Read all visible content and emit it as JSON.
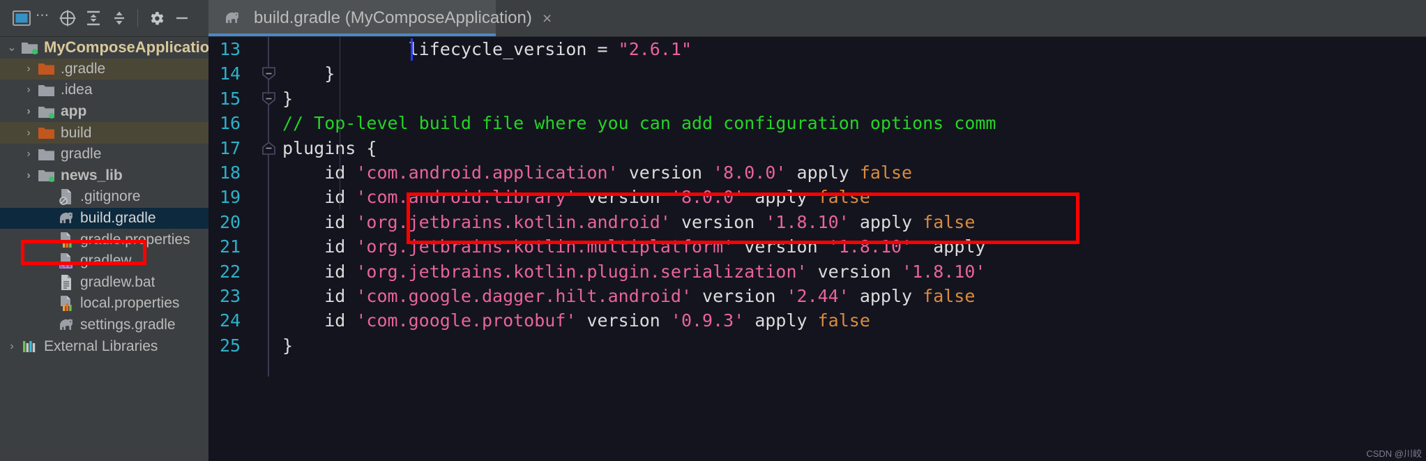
{
  "toolbar": {
    "icons": [
      {
        "name": "project-window-icon",
        "label": "Project"
      },
      {
        "name": "ellipsis-icon",
        "label": "..."
      },
      {
        "name": "select-opened-file-icon",
        "label": "Select Opened File"
      },
      {
        "name": "expand-all-icon",
        "label": "Expand All"
      },
      {
        "name": "collapse-all-icon",
        "label": "Collapse All"
      },
      {
        "name": "gear-icon",
        "label": "Settings"
      },
      {
        "name": "minimize-icon",
        "label": "Hide"
      }
    ]
  },
  "tab": {
    "title": "build.gradle (MyComposeApplication)",
    "close_label": "×",
    "icon": "gradle-elephant-icon",
    "active_underline_color": "#4a88c7"
  },
  "sidebar": {
    "items": [
      {
        "label": "MyComposeApplication",
        "icon": "module-folder-icon",
        "arrow": "⌄",
        "indent": 0,
        "state": "root"
      },
      {
        "label": ".gradle",
        "icon": "folder-orange-icon",
        "arrow": "›",
        "indent": 1,
        "state": "excluded"
      },
      {
        "label": ".idea",
        "icon": "folder-icon",
        "arrow": "›",
        "indent": 1,
        "state": "normal"
      },
      {
        "label": "app",
        "icon": "module-folder-icon",
        "arrow": "›",
        "indent": 1,
        "state": "bold"
      },
      {
        "label": "build",
        "icon": "folder-orange-icon",
        "arrow": "›",
        "indent": 1,
        "state": "excluded"
      },
      {
        "label": "gradle",
        "icon": "folder-icon",
        "arrow": "›",
        "indent": 1,
        "state": "normal"
      },
      {
        "label": "news_lib",
        "icon": "module-folder-icon",
        "arrow": "›",
        "indent": 1,
        "state": "bold"
      },
      {
        "label": ".gitignore",
        "icon": "gitignore-file-icon",
        "arrow": "",
        "indent": 2,
        "state": "normal"
      },
      {
        "label": "build.gradle",
        "icon": "gradle-elephant-icon",
        "arrow": "",
        "indent": 2,
        "state": "selected"
      },
      {
        "label": "gradle.properties",
        "icon": "properties-file-icon",
        "arrow": "",
        "indent": 2,
        "state": "normal"
      },
      {
        "label": "gradlew",
        "icon": "cpp-file-icon",
        "arrow": "",
        "indent": 2,
        "state": "normal"
      },
      {
        "label": "gradlew.bat",
        "icon": "text-file-icon",
        "arrow": "",
        "indent": 2,
        "state": "normal"
      },
      {
        "label": "local.properties",
        "icon": "properties-file-icon",
        "arrow": "",
        "indent": 2,
        "state": "normal"
      },
      {
        "label": "settings.gradle",
        "icon": "gradle-elephant-icon",
        "arrow": "",
        "indent": 2,
        "state": "normal"
      },
      {
        "label": "External Libraries",
        "icon": "libraries-icon",
        "arrow": "›",
        "indent": 0,
        "state": "normal"
      }
    ]
  },
  "editor": {
    "first_line_number": 13,
    "lines": [
      {
        "n": 13,
        "fold": "none",
        "tokens": [
          {
            "t": "            lifecycle_version = ",
            "c": "txt"
          },
          {
            "t": "\"2.6.1\"",
            "c": "str"
          }
        ]
      },
      {
        "n": 14,
        "fold": "end",
        "tokens": [
          {
            "t": "    }",
            "c": "txt"
          }
        ]
      },
      {
        "n": 15,
        "fold": "end",
        "tokens": [
          {
            "t": "}",
            "c": "txt"
          }
        ]
      },
      {
        "n": 16,
        "fold": "none",
        "tokens": [
          {
            "t": "// Top-level build file where you can add configuration options comm",
            "c": "com"
          }
        ]
      },
      {
        "n": 17,
        "fold": "start",
        "tokens": [
          {
            "t": "plugins {",
            "c": "txt"
          }
        ]
      },
      {
        "n": 18,
        "fold": "none",
        "tokens": [
          {
            "t": "    id ",
            "c": "txt"
          },
          {
            "t": "'com.android.application'",
            "c": "str"
          },
          {
            "t": " version ",
            "c": "txt"
          },
          {
            "t": "'8.0.0'",
            "c": "str"
          },
          {
            "t": " apply ",
            "c": "txt"
          },
          {
            "t": "false",
            "c": "kw"
          }
        ]
      },
      {
        "n": 19,
        "fold": "none",
        "tokens": [
          {
            "t": "    id ",
            "c": "txt"
          },
          {
            "t": "'com.android.library'",
            "c": "str"
          },
          {
            "t": " version ",
            "c": "txt"
          },
          {
            "t": "'8.0.0'",
            "c": "str"
          },
          {
            "t": " apply ",
            "c": "txt"
          },
          {
            "t": "false",
            "c": "kw"
          }
        ]
      },
      {
        "n": 20,
        "fold": "none",
        "tokens": [
          {
            "t": "    id ",
            "c": "txt"
          },
          {
            "t": "'org.jetbrains.kotlin.android'",
            "c": "str"
          },
          {
            "t": " version ",
            "c": "txt"
          },
          {
            "t": "'1.8.10'",
            "c": "str"
          },
          {
            "t": " apply ",
            "c": "txt"
          },
          {
            "t": "false",
            "c": "kw"
          }
        ]
      },
      {
        "n": 21,
        "fold": "none",
        "tokens": [
          {
            "t": "    id ",
            "c": "txt"
          },
          {
            "t": "'org.jetbrains.kotlin.multiplatform'",
            "c": "str"
          },
          {
            "t": " version ",
            "c": "txt"
          },
          {
            "t": "'1.8.10'",
            "c": "str"
          },
          {
            "t": "  apply",
            "c": "txt"
          }
        ]
      },
      {
        "n": 22,
        "fold": "none",
        "tokens": [
          {
            "t": "    id ",
            "c": "txt"
          },
          {
            "t": "'org.jetbrains.kotlin.plugin.serialization'",
            "c": "str"
          },
          {
            "t": " version ",
            "c": "txt"
          },
          {
            "t": "'1.8.10'",
            "c": "str"
          }
        ]
      },
      {
        "n": 23,
        "fold": "none",
        "tokens": [
          {
            "t": "    id ",
            "c": "txt"
          },
          {
            "t": "'com.google.dagger.hilt.android'",
            "c": "str"
          },
          {
            "t": " version ",
            "c": "txt"
          },
          {
            "t": "'2.44'",
            "c": "str"
          },
          {
            "t": " apply ",
            "c": "txt"
          },
          {
            "t": "false",
            "c": "kw"
          }
        ]
      },
      {
        "n": 24,
        "fold": "none",
        "tokens": [
          {
            "t": "    id ",
            "c": "txt"
          },
          {
            "t": "'com.google.protobuf'",
            "c": "str"
          },
          {
            "t": " version ",
            "c": "txt"
          },
          {
            "t": "'0.9.3'",
            "c": "str"
          },
          {
            "t": " apply ",
            "c": "txt"
          },
          {
            "t": "false",
            "c": "kw"
          }
        ]
      },
      {
        "n": 25,
        "fold": "none",
        "tokens": [
          {
            "t": "}",
            "c": "txt"
          }
        ]
      }
    ],
    "watermark": "CSDN @川峧"
  },
  "annotations": {
    "tree_box_color": "#fe0000",
    "code_box_color": "#fe0000"
  }
}
